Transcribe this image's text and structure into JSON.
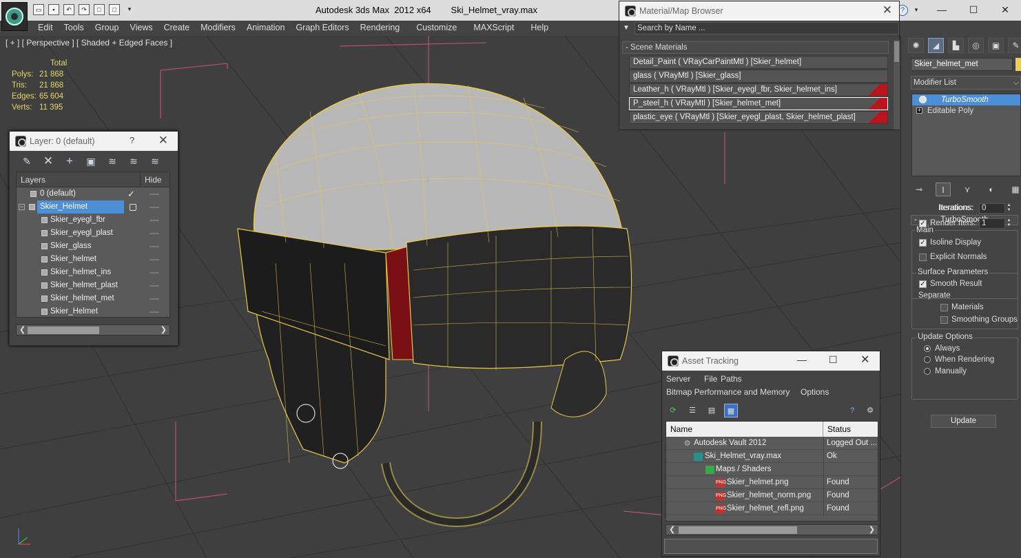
{
  "app": {
    "title": "Autodesk 3ds Max  2012 x64        Ski_Helmet_vray.max",
    "quick_access": [
      "open",
      "save",
      "undo",
      "redo",
      "hold",
      "fetch",
      "more"
    ]
  },
  "menu": [
    "Edit",
    "Tools",
    "Group",
    "Views",
    "Create",
    "Modifiers",
    "Animation",
    "Graph Editors",
    "Rendering",
    "Customize",
    "MAXScript",
    "Help"
  ],
  "viewport": {
    "label": "[ + ] [ Perspective ] [ Shaded + Edged Faces ]",
    "stats": {
      "header": "Total",
      "rows": [
        {
          "key": "Polys:",
          "value": "21 868"
        },
        {
          "key": "Tris:",
          "value": "21 868"
        },
        {
          "key": "Edges:",
          "value": "65 604"
        },
        {
          "key": "Verts:",
          "value": "11 395"
        }
      ]
    },
    "axis_label": "z",
    "colors": {
      "background": "#3f3f3f",
      "wire": "#e8c84a",
      "grid": "#2f2f2f",
      "gizmo": "#e060a0"
    }
  },
  "layer_window": {
    "title": "Layer: 0 (default)",
    "help": "?",
    "close": "✕",
    "col_layers": "Layers",
    "col_hide": "Hide",
    "rows": [
      {
        "name": "0 (default)",
        "kind": "layer",
        "active": true
      },
      {
        "name": "Skier_Helmet",
        "kind": "layer",
        "selected": true
      },
      {
        "name": "Skier_eyegl_fbr",
        "kind": "object"
      },
      {
        "name": "Skier_eyegl_plast",
        "kind": "object"
      },
      {
        "name": "Skier_glass",
        "kind": "object"
      },
      {
        "name": "Skier_helmet",
        "kind": "object"
      },
      {
        "name": "Skier_helmet_ins",
        "kind": "object"
      },
      {
        "name": "Skier_helmet_plast",
        "kind": "object"
      },
      {
        "name": "Skier_helmet_met",
        "kind": "object"
      },
      {
        "name": "Skier_Helmet",
        "kind": "object"
      }
    ]
  },
  "material_browser": {
    "title": "Material/Map Browser",
    "search_placeholder": "Search by Name ...",
    "group": "- Scene Materials",
    "rows": [
      {
        "text": "Detail_Paint  ( VRayCarPaintMtl ) [Skier_helmet]"
      },
      {
        "text": "glass  ( VRayMtl ) [Skier_glass]"
      },
      {
        "text": "Leather_h  ( VRayMtl ) [Skier_eyegl_fbr, Skier_helmet_ins]"
      },
      {
        "text": "P_steel_h  ( VRayMtl ) [Skier_helmet_met]",
        "selected": true
      },
      {
        "text": "plastic_eye  ( VRayMtl ) [Skier_eyegl_plast, Skier_helmet_plast]"
      }
    ]
  },
  "command_panel": {
    "object_name": "Skier_helmet_met",
    "modifier_list": "Modifier List",
    "stack": [
      {
        "name": "TurboSmooth",
        "selected": true
      },
      {
        "name": "Editable Poly"
      }
    ],
    "rollout_title": "TurboSmooth",
    "main_group": "Main",
    "iterations_label": "Iterations:",
    "iterations_value": "0",
    "render_iters_label": "Render Iters:",
    "render_iters_value": "1",
    "isoline_display": "Isoline Display",
    "explicit_normals": "Explicit Normals",
    "surface_params": "Surface Parameters",
    "smooth_result": "Smooth Result",
    "separate": "Separate",
    "materials": "Materials",
    "smoothing_groups": "Smoothing Groups",
    "update_options": "Update Options",
    "always": "Always",
    "when_rendering": "When Rendering",
    "manually": "Manually",
    "update_button": "Update"
  },
  "asset_tracking": {
    "title": "Asset Tracking",
    "menu1": [
      "Server",
      "File",
      "Paths"
    ],
    "menu2": [
      "Bitmap Performance and Memory",
      "Options"
    ],
    "col_name": "Name",
    "col_status": "Status",
    "rows": [
      {
        "name": "Autodesk Vault 2012",
        "status": "Logged Out ...",
        "indent": 0,
        "icon": "vault-icon"
      },
      {
        "name": "Ski_Helmet_vray.max",
        "status": "Ok",
        "indent": 1,
        "icon": "max-file-icon"
      },
      {
        "name": "Maps / Shaders",
        "status": "",
        "indent": 2,
        "icon": "maps-icon"
      },
      {
        "name": "Skier_helmet.png",
        "status": "Found",
        "indent": 3,
        "icon": "png-icon"
      },
      {
        "name": "Skier_helmet_norm.png",
        "status": "Found",
        "indent": 3,
        "icon": "png-icon"
      },
      {
        "name": "Skier_helmet_refl.png",
        "status": "Found",
        "indent": 3,
        "icon": "png-icon"
      }
    ],
    "png_label": "PNG"
  }
}
